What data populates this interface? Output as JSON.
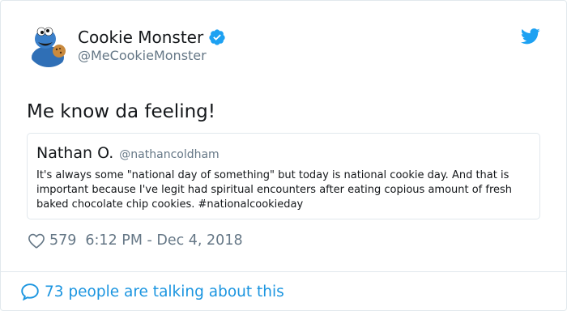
{
  "tweet": {
    "author": {
      "name": "Cookie Monster",
      "handle": "@MeCookieMonster",
      "verified": true,
      "avatar_icon": "cookie-monster-avatar"
    },
    "text": "Me know da feeling!",
    "quoted_tweet": {
      "name": "Nathan O.",
      "handle": "@nathancoldham",
      "text": "It's always some \"national day of something\" but today is national cookie day. And that is important because I've legit had spiritual encounters after eating copious amount of fresh baked chocolate chip cookies. #nationalcookieday"
    },
    "likes": "579",
    "timestamp": "6:12 PM - Dec 4, 2018",
    "conversation": "73 people are talking about this"
  },
  "icons": {
    "brand": "twitter-bird-icon",
    "verified": "verified-badge-icon",
    "like": "heart-icon",
    "reply": "speech-bubble-icon"
  },
  "colors": {
    "brand_blue": "#1da1f2",
    "link_blue": "#1b95e0",
    "secondary_text": "#657786",
    "border": "#e1e8ed"
  }
}
